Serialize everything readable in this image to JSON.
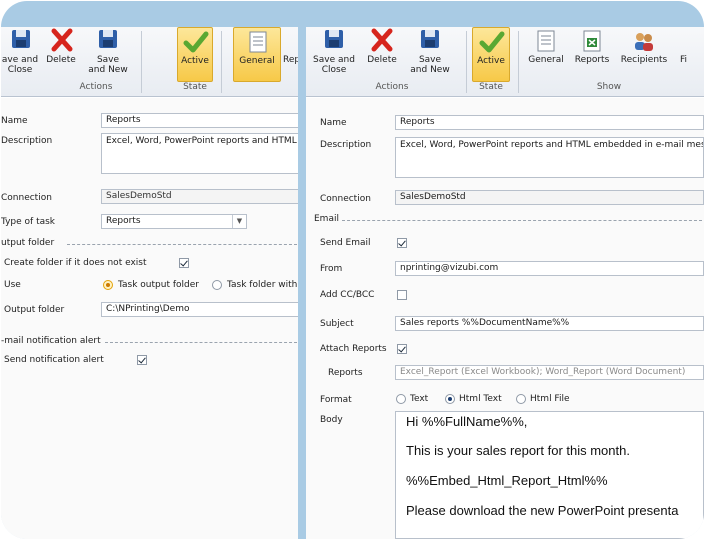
{
  "left_ribbon": {
    "save_close": "ave and\nClose",
    "delete": "Delete",
    "save_new": "Save\nand New",
    "active": "Active",
    "general": "General",
    "rep": "Rep",
    "group_actions": "Actions",
    "group_state": "State"
  },
  "left_form": {
    "name_label": "Name",
    "name_value": "Reports",
    "description_label": "Description",
    "description_value": "Excel, Word, PowerPoint reports and HTML en",
    "connection_label": "Connection",
    "connection_value": "SalesDemoStd",
    "type_label": "Type of task",
    "type_value": "Reports",
    "output_section": "utput folder",
    "create_folder_label": "Create folder if it does not exist",
    "use_label": "Use",
    "use_opt1": "Task output folder",
    "use_opt2": "Task folder with r",
    "output_folder_label": "Output folder",
    "output_folder_value": "C:\\NPrinting\\Demo",
    "email_section": "-mail notification alert",
    "send_alert_label": "Send notification alert"
  },
  "right_ribbon": {
    "save_close": "Save and\nClose",
    "delete": "Delete",
    "save_new": "Save\nand New",
    "active": "Active",
    "general": "General",
    "reports": "Reports",
    "recipients": "Recipients",
    "fi": "Fi",
    "group_actions": "Actions",
    "group_state": "State",
    "group_show": "Show"
  },
  "right_form": {
    "name_label": "Name",
    "name_value": "Reports",
    "description_label": "Description",
    "description_value": "Excel, Word, PowerPoint  reports and HTML embedded in e-mail messa",
    "connection_label": "Connection",
    "connection_value": "SalesDemoStd",
    "email_section": "Email",
    "send_email_label": "Send Email",
    "from_label": "From",
    "from_value": "nprinting@vizubi.com",
    "cc_label": "Add CC/BCC",
    "subject_label": "Subject",
    "subject_value": "Sales reports %%DocumentName%%",
    "attach_label": "Attach Reports",
    "reports_label": "Reports",
    "reports_value": "Excel_Report (Excel Workbook); Word_Report (Word Document)",
    "format_label": "Format",
    "format_text": "Text",
    "format_html_text": "Html Text",
    "format_html_file": "Html File",
    "body_label": "Body",
    "body_lines": [
      "Hi %%FullName%%,",
      "This is your sales report for this month.",
      "%%Embed_Html_Report_Html%%",
      "Please download the new PowerPoint presenta"
    ]
  },
  "colors": {
    "frame": "#a9cbe4",
    "highlight": "#f7c948",
    "check_green": "#5aa832",
    "delete_red": "#d6251d"
  }
}
